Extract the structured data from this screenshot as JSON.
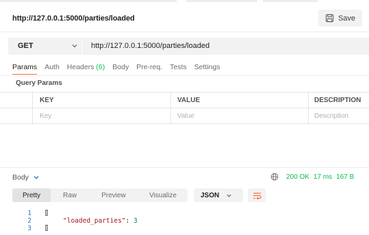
{
  "header": {
    "title": "http://127.0.0.1:5000/parties/loaded",
    "save_label": "Save"
  },
  "request": {
    "method": "GET",
    "url": "http://127.0.0.1:5000/parties/loaded"
  },
  "tabs": [
    {
      "label": "Params",
      "active": true
    },
    {
      "label": "Auth"
    },
    {
      "label": "Headers",
      "count": "(6)"
    },
    {
      "label": "Body"
    },
    {
      "label": "Pre-req."
    },
    {
      "label": "Tests"
    },
    {
      "label": "Settings"
    }
  ],
  "query_params": {
    "label": "Query Params",
    "columns": [
      "KEY",
      "VALUE",
      "DESCRIPTION"
    ],
    "placeholders": [
      "Key",
      "Value",
      "Description"
    ]
  },
  "response": {
    "body_label": "Body",
    "status": "200 OK",
    "time": "17 ms",
    "size": "167 B",
    "view_tabs": [
      "Pretty",
      "Raw",
      "Preview",
      "Visualize"
    ],
    "format": "JSON",
    "code": {
      "line_numbers": [
        "1",
        "2",
        "3"
      ],
      "key": "\"loaded_parties\"",
      "colon": ": ",
      "value": "3"
    }
  },
  "colors": {
    "accent": "#ff6c37",
    "success": "#0cbb52",
    "json_key": "#a31515"
  },
  "icons": [
    "save-icon",
    "chevron-down-icon",
    "globe-icon",
    "wrap-lines-icon"
  ]
}
